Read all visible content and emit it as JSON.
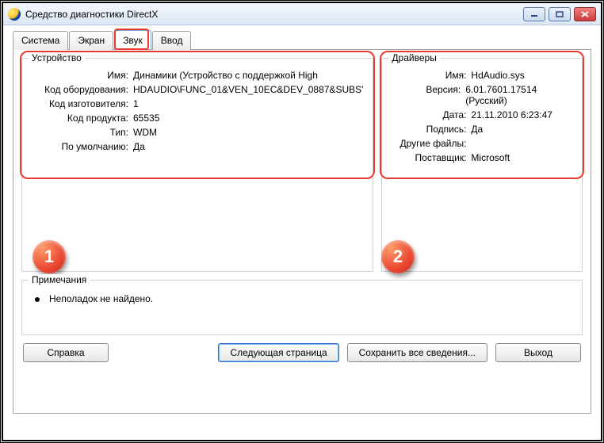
{
  "window": {
    "title": "Средство диагностики DirectX"
  },
  "tabs": {
    "t0": "Система",
    "t1": "Экран",
    "t2": "Звук",
    "t3": "Ввод"
  },
  "annotations": {
    "badge1": "1",
    "badge2": "2"
  },
  "device": {
    "legend": "Устройство",
    "labels": {
      "name": "Имя:",
      "hwid": "Код оборудования:",
      "mfr": "Код изготовителя:",
      "prod": "Код продукта:",
      "type": "Тип:",
      "default": "По умолчанию:"
    },
    "values": {
      "name": "Динамики (Устройство с поддержкой High",
      "hwid": "HDAUDIO\\FUNC_01&VEN_10EC&DEV_0887&SUBS'",
      "mfr": "1",
      "prod": "65535",
      "type": "WDM",
      "default": "Да"
    }
  },
  "drivers": {
    "legend": "Драйверы",
    "labels": {
      "name": "Имя:",
      "version": "Версия:",
      "date": "Дата:",
      "signed": "Подпись:",
      "other": "Другие файлы:",
      "vendor": "Поставщик:"
    },
    "values": {
      "name": "HdAudio.sys",
      "version": "6.01.7601.17514 (Русский)",
      "date": "21.11.2010 6:23:47",
      "signed": "Да",
      "other": "",
      "vendor": "Microsoft"
    }
  },
  "notes": {
    "legend": "Примечания",
    "line1": "Неполадок не найдено."
  },
  "buttons": {
    "help": "Справка",
    "next": "Следующая страница",
    "save": "Сохранить все сведения...",
    "exit": "Выход"
  }
}
